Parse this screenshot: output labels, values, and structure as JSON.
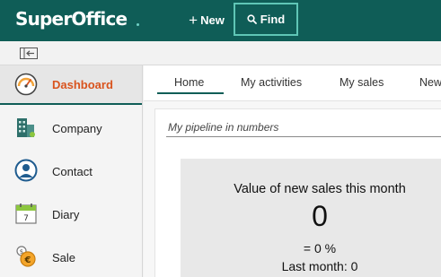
{
  "app": {
    "logo_text": "SuperOffice",
    "new_label": "New",
    "find_label": "Find"
  },
  "sidebar": {
    "items": [
      {
        "label": "Dashboard",
        "icon": "dashboard-gauge-icon",
        "active": true
      },
      {
        "label": "Company",
        "icon": "company-building-icon",
        "active": false
      },
      {
        "label": "Contact",
        "icon": "contact-person-icon",
        "active": false
      },
      {
        "label": "Diary",
        "icon": "diary-calendar-icon",
        "active": false
      },
      {
        "label": "Sale",
        "icon": "sale-coin-icon",
        "active": false
      }
    ],
    "diary_icon_day": "7"
  },
  "tabs": [
    {
      "label": "Home",
      "active": true
    },
    {
      "label": "My activities",
      "active": false
    },
    {
      "label": "My sales",
      "active": false
    },
    {
      "label": "New",
      "active": false
    }
  ],
  "pipeline": {
    "section_title": "My pipeline in numbers",
    "kpi_title": "Value of new sales this month",
    "kpi_value": "0",
    "kpi_percent": "= 0 %",
    "kpi_last_month": "Last month: 0"
  },
  "colors": {
    "topbar": "#0f5d57",
    "accent": "#5fc6b6",
    "active_nav_text": "#d9541e"
  }
}
